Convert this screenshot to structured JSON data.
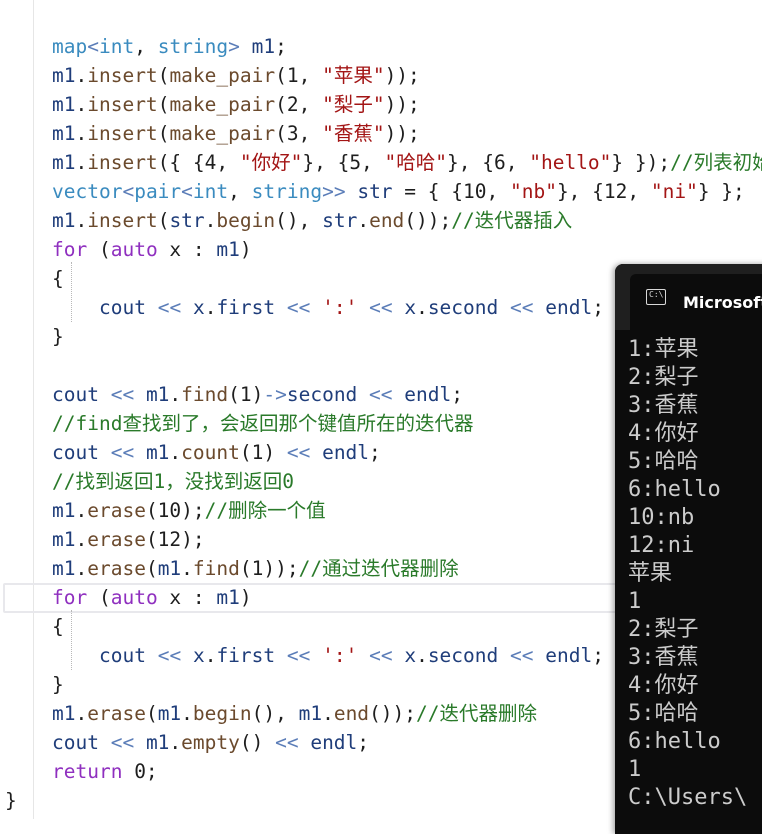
{
  "editor": {
    "lines": [
      [
        [
          "t-type",
          "map"
        ],
        [
          "t-op",
          "<"
        ],
        [
          "t-type",
          "int"
        ],
        [
          "",
          ", "
        ],
        [
          "t-type",
          "string"
        ],
        [
          "t-op",
          "> "
        ],
        [
          "t-var",
          "m1"
        ],
        [
          "",
          ";"
        ]
      ],
      [
        [
          "t-var",
          "m1"
        ],
        [
          "",
          "."
        ],
        [
          "t-fn",
          "insert"
        ],
        [
          "",
          "("
        ],
        [
          "t-fn",
          "make_pair"
        ],
        [
          "",
          "(1, "
        ],
        [
          "t-str",
          "\"苹果\""
        ],
        [
          "",
          "));"
        ]
      ],
      [
        [
          "t-var",
          "m1"
        ],
        [
          "",
          "."
        ],
        [
          "t-fn",
          "insert"
        ],
        [
          "",
          "("
        ],
        [
          "t-fn",
          "make_pair"
        ],
        [
          "",
          "(2, "
        ],
        [
          "t-str",
          "\"梨子\""
        ],
        [
          "",
          "));"
        ]
      ],
      [
        [
          "t-var",
          "m1"
        ],
        [
          "",
          "."
        ],
        [
          "t-fn",
          "insert"
        ],
        [
          "",
          "("
        ],
        [
          "t-fn",
          "make_pair"
        ],
        [
          "",
          "(3, "
        ],
        [
          "t-str",
          "\"香蕉\""
        ],
        [
          "",
          "));"
        ]
      ],
      [
        [
          "t-var",
          "m1"
        ],
        [
          "",
          "."
        ],
        [
          "t-fn",
          "insert"
        ],
        [
          "",
          "({ {4, "
        ],
        [
          "t-str",
          "\"你好\""
        ],
        [
          "",
          "}, {5, "
        ],
        [
          "t-str",
          "\"哈哈\""
        ],
        [
          "",
          "}, {6, "
        ],
        [
          "t-str",
          "\"hello\""
        ],
        [
          "",
          "} });"
        ],
        [
          "t-cm",
          "//列表初始化"
        ]
      ],
      [
        [
          "t-type",
          "vector"
        ],
        [
          "t-op",
          "<"
        ],
        [
          "t-type",
          "pair"
        ],
        [
          "t-op",
          "<"
        ],
        [
          "t-type",
          "int"
        ],
        [
          "",
          ", "
        ],
        [
          "t-type",
          "string"
        ],
        [
          "t-op",
          ">> "
        ],
        [
          "t-var",
          "str"
        ],
        [
          "",
          " = { {10, "
        ],
        [
          "t-str",
          "\"nb\""
        ],
        [
          "",
          "}, {12, "
        ],
        [
          "t-str",
          "\"ni\""
        ],
        [
          "",
          "} };"
        ]
      ],
      [
        [
          "t-var",
          "m1"
        ],
        [
          "",
          "."
        ],
        [
          "t-fn",
          "insert"
        ],
        [
          "",
          "("
        ],
        [
          "t-var",
          "str"
        ],
        [
          "",
          "."
        ],
        [
          "t-fn",
          "begin"
        ],
        [
          "",
          "(), "
        ],
        [
          "t-var",
          "str"
        ],
        [
          "",
          "."
        ],
        [
          "t-fn",
          "end"
        ],
        [
          "",
          "());"
        ],
        [
          "t-cm",
          "//迭代器插入"
        ]
      ],
      [
        [
          "t-kw",
          "for"
        ],
        [
          "",
          " ("
        ],
        [
          "t-kw",
          "auto"
        ],
        [
          "",
          " x : "
        ],
        [
          "t-var",
          "m1"
        ],
        [
          "",
          ")"
        ]
      ],
      [
        [
          "",
          "{"
        ]
      ],
      [
        [
          "t-var",
          "cout"
        ],
        [
          "t-op",
          " << "
        ],
        [
          "t-var",
          "x"
        ],
        [
          "",
          "."
        ],
        [
          "t-var",
          "first"
        ],
        [
          "t-op",
          " << "
        ],
        [
          "t-str",
          "':'"
        ],
        [
          "t-op",
          " << "
        ],
        [
          "t-var",
          "x"
        ],
        [
          "",
          "."
        ],
        [
          "t-var",
          "second"
        ],
        [
          "t-op",
          " << "
        ],
        [
          "t-var",
          "endl"
        ],
        [
          "",
          ";"
        ]
      ],
      [
        [
          "",
          "}"
        ]
      ],
      [
        [
          "",
          ""
        ]
      ],
      [
        [
          "t-var",
          "cout"
        ],
        [
          "t-op",
          " << "
        ],
        [
          "t-var",
          "m1"
        ],
        [
          "",
          "."
        ],
        [
          "t-fn",
          "find"
        ],
        [
          "",
          "(1)"
        ],
        [
          "t-op",
          "->"
        ],
        [
          "t-var",
          "second"
        ],
        [
          "t-op",
          " << "
        ],
        [
          "t-var",
          "endl"
        ],
        [
          "",
          ";"
        ]
      ],
      [
        [
          "t-cm",
          "//find查找到了，会返回那个键值所在的迭代器"
        ]
      ],
      [
        [
          "t-var",
          "cout"
        ],
        [
          "t-op",
          " << "
        ],
        [
          "t-var",
          "m1"
        ],
        [
          "",
          "."
        ],
        [
          "t-fn",
          "count"
        ],
        [
          "",
          "(1)"
        ],
        [
          "t-op",
          " << "
        ],
        [
          "t-var",
          "endl"
        ],
        [
          "",
          ";"
        ]
      ],
      [
        [
          "t-cm",
          "//找到返回1，没找到返回0"
        ]
      ],
      [
        [
          "t-var",
          "m1"
        ],
        [
          "",
          "."
        ],
        [
          "t-fn",
          "erase"
        ],
        [
          "",
          "(10);"
        ],
        [
          "t-cm",
          "//删除一个值"
        ]
      ],
      [
        [
          "t-var",
          "m1"
        ],
        [
          "",
          "."
        ],
        [
          "t-fn",
          "erase"
        ],
        [
          "",
          "(12);"
        ]
      ],
      [
        [
          "t-var",
          "m1"
        ],
        [
          "",
          "."
        ],
        [
          "t-fn",
          "erase"
        ],
        [
          "",
          "("
        ],
        [
          "t-var",
          "m1"
        ],
        [
          "",
          "."
        ],
        [
          "t-fn",
          "find"
        ],
        [
          "",
          "(1));"
        ],
        [
          "t-cm",
          "//通过迭代器删除"
        ]
      ],
      [
        [
          "t-kw",
          "for"
        ],
        [
          "",
          " ("
        ],
        [
          "t-kw",
          "auto"
        ],
        [
          "",
          " x : "
        ],
        [
          "t-var",
          "m1"
        ],
        [
          "",
          ")"
        ]
      ],
      [
        [
          "",
          "{"
        ]
      ],
      [
        [
          "t-var",
          "cout"
        ],
        [
          "t-op",
          " << "
        ],
        [
          "t-var",
          "x"
        ],
        [
          "",
          "."
        ],
        [
          "t-var",
          "first"
        ],
        [
          "t-op",
          " << "
        ],
        [
          "t-str",
          "':'"
        ],
        [
          "t-op",
          " << "
        ],
        [
          "t-var",
          "x"
        ],
        [
          "",
          "."
        ],
        [
          "t-var",
          "second"
        ],
        [
          "t-op",
          " << "
        ],
        [
          "t-var",
          "endl"
        ],
        [
          "",
          ";"
        ]
      ],
      [
        [
          "",
          "}"
        ]
      ],
      [
        [
          "t-var",
          "m1"
        ],
        [
          "",
          "."
        ],
        [
          "t-fn",
          "erase"
        ],
        [
          "",
          "("
        ],
        [
          "t-var",
          "m1"
        ],
        [
          "",
          "."
        ],
        [
          "t-fn",
          "begin"
        ],
        [
          "",
          "(), "
        ],
        [
          "t-var",
          "m1"
        ],
        [
          "",
          "."
        ],
        [
          "t-fn",
          "end"
        ],
        [
          "",
          "());"
        ],
        [
          "t-cm",
          "//迭代器删除"
        ]
      ],
      [
        [
          "t-var",
          "cout"
        ],
        [
          "t-op",
          " << "
        ],
        [
          "t-var",
          "m1"
        ],
        [
          "",
          "."
        ],
        [
          "t-fn",
          "empty"
        ],
        [
          "",
          "()"
        ],
        [
          "t-op",
          " << "
        ],
        [
          "t-var",
          "endl"
        ],
        [
          "",
          ";"
        ]
      ],
      [
        [
          "t-kw",
          "return"
        ],
        [
          "",
          " 0;"
        ]
      ],
      [
        [
          "",
          "}"
        ]
      ]
    ]
  },
  "console": {
    "title": "Microsoft Visual Studio 调试控制台",
    "output": [
      "1:苹果",
      "2:梨子",
      "3:香蕉",
      "4:你好",
      "5:哈哈",
      "6:hello",
      "10:nb",
      "12:ni",
      "苹果",
      "1",
      "2:梨子",
      "3:香蕉",
      "4:你好",
      "5:哈哈",
      "6:hello",
      "1",
      "C:\\Users\\"
    ]
  }
}
